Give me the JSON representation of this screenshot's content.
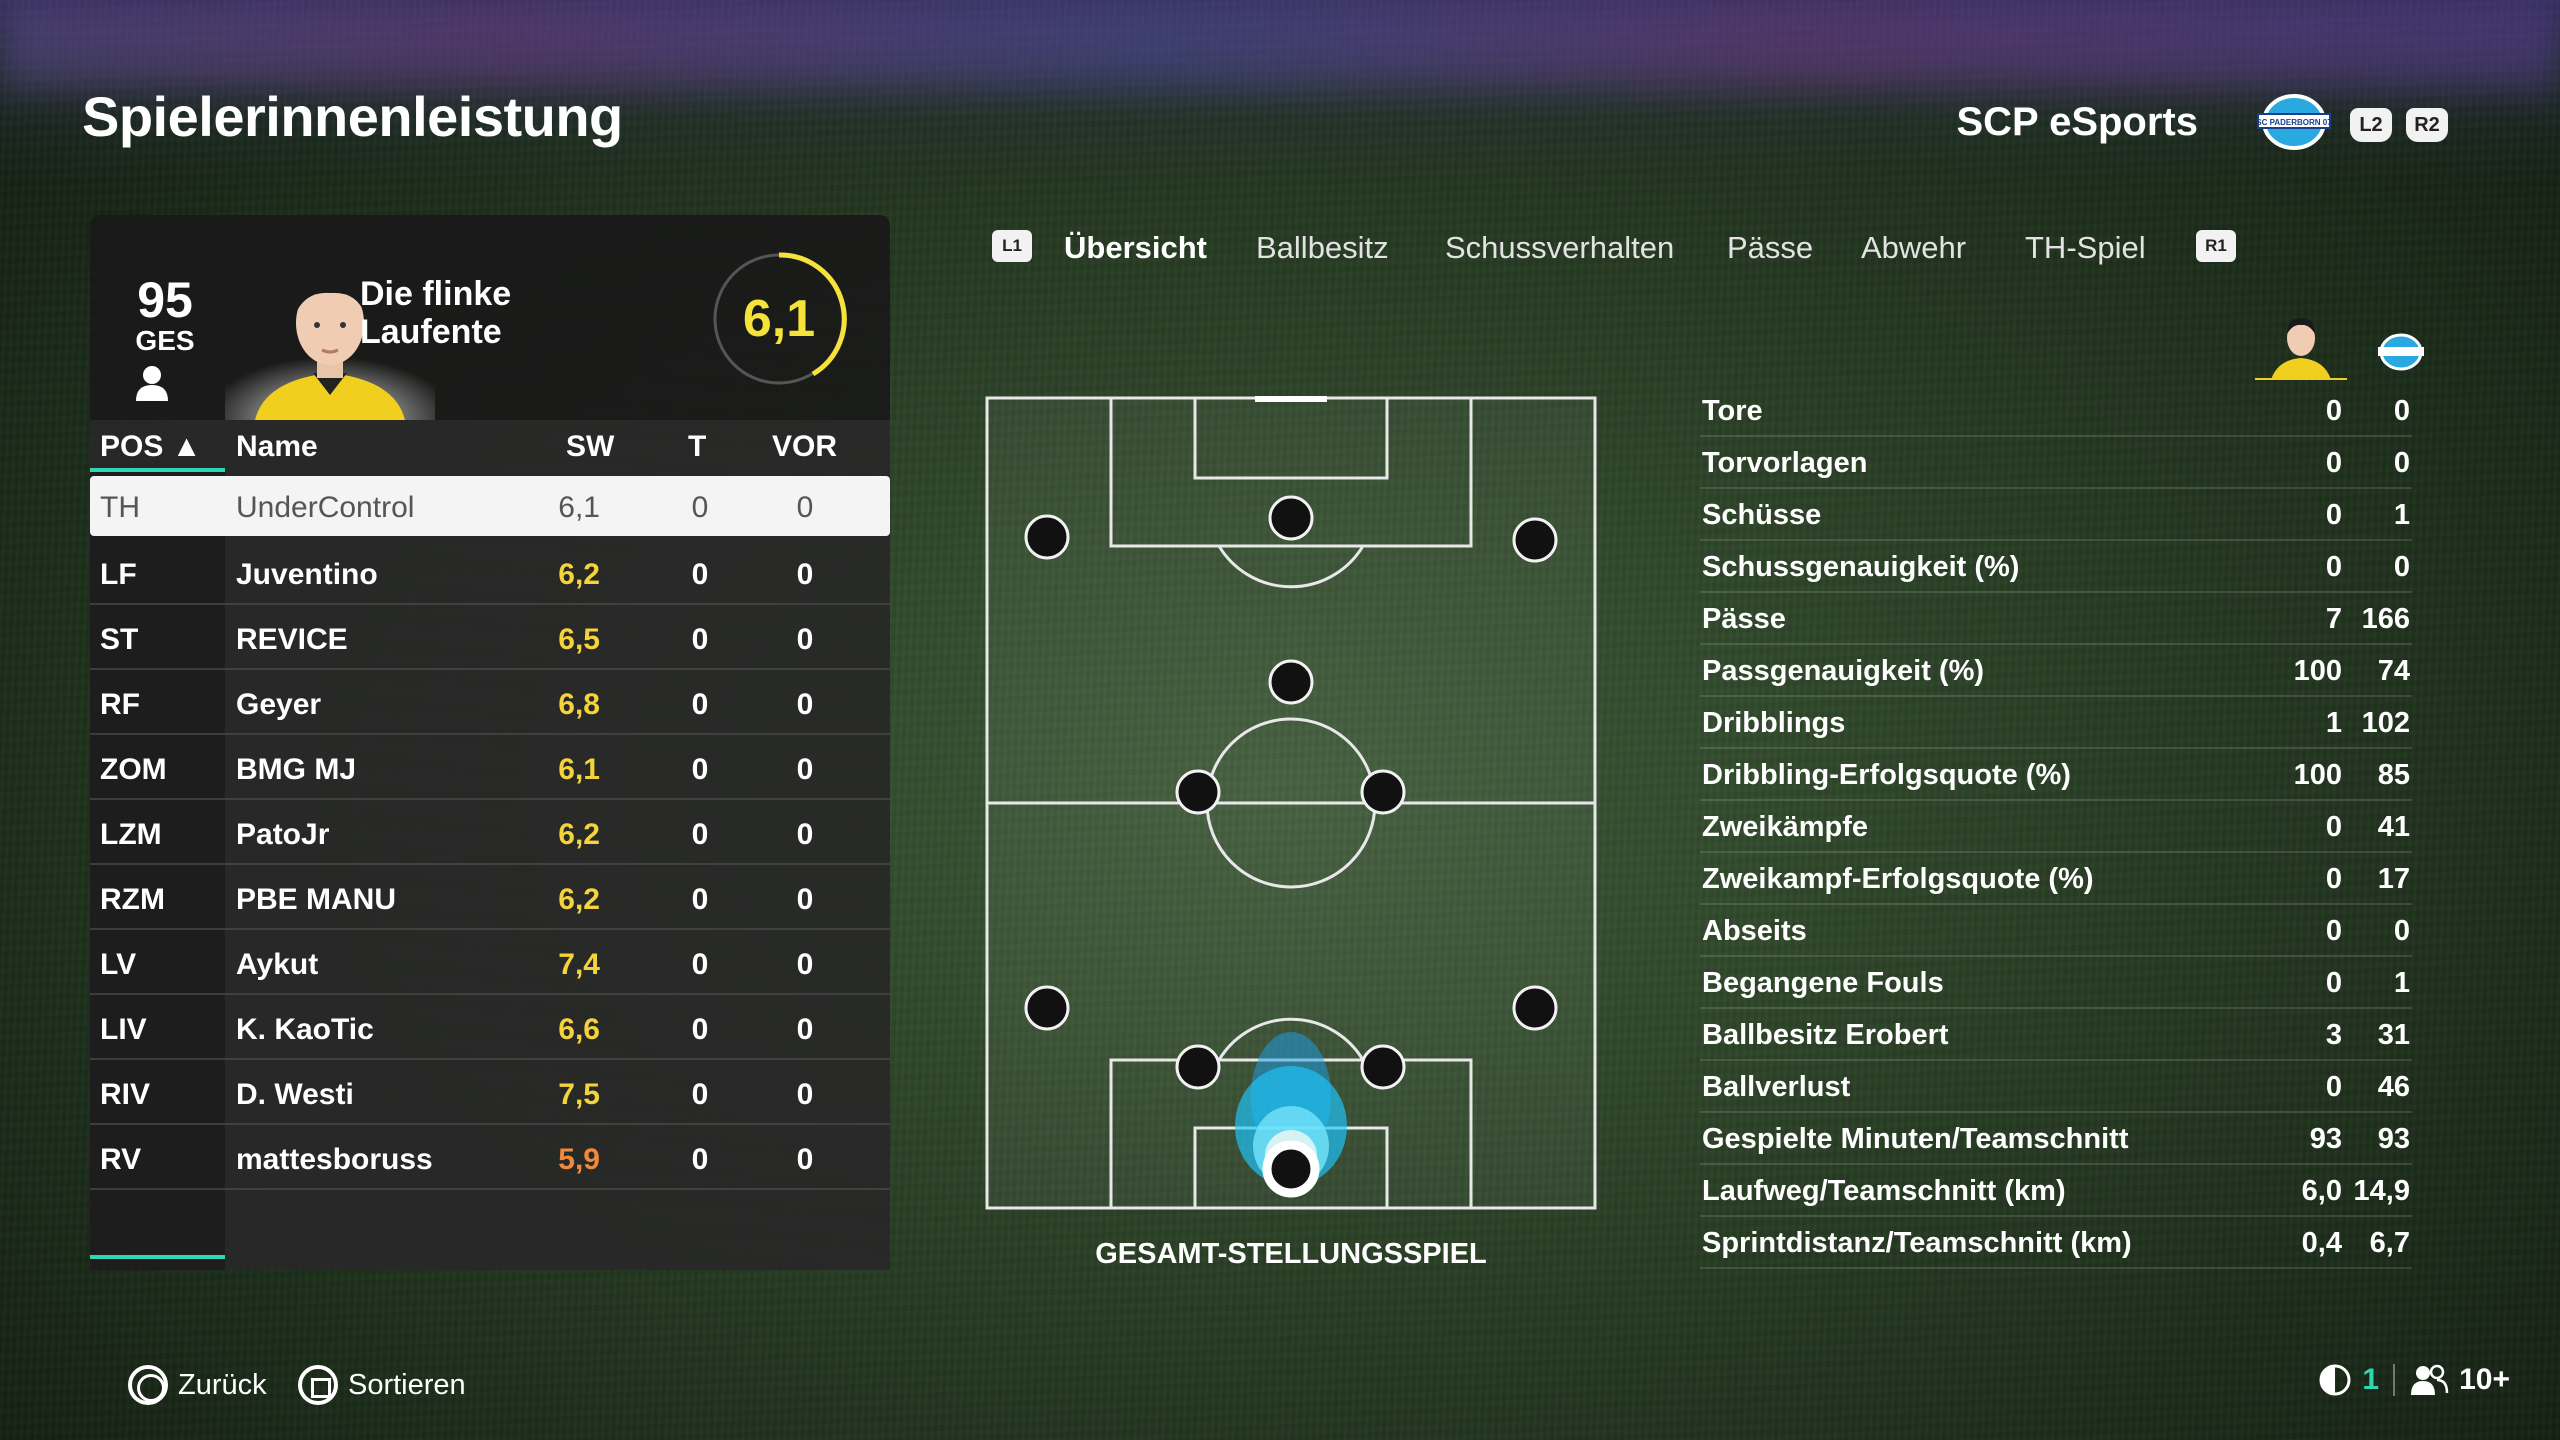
{
  "header": {
    "title": "Spielerinnenleistung",
    "team_name": "SCP eSports",
    "crest_text": "SC PADERBORN 07",
    "l2": "L2",
    "r2": "R2"
  },
  "player": {
    "overall": "95",
    "overall_label": "GES",
    "name_line1": "Die flinke",
    "name_line2": "Laufente",
    "rating": "6,1"
  },
  "table": {
    "headers": {
      "pos": "POS ▲",
      "name": "Name",
      "sw": "SW",
      "t": "T",
      "vor": "VOR"
    },
    "rows": [
      {
        "pos": "TH",
        "name": "UnderControl",
        "sw": "6,1",
        "sw_color": "#555555",
        "t": "0",
        "vor": "0"
      },
      {
        "pos": "LF",
        "name": "Juventino",
        "sw": "6,2",
        "sw_color": "#f5d33a",
        "t": "0",
        "vor": "0"
      },
      {
        "pos": "ST",
        "name": "REVICE",
        "sw": "6,5",
        "sw_color": "#f5d33a",
        "t": "0",
        "vor": "0"
      },
      {
        "pos": "RF",
        "name": "Geyer",
        "sw": "6,8",
        "sw_color": "#f5d33a",
        "t": "0",
        "vor": "0"
      },
      {
        "pos": "ZOM",
        "name": "BMG MJ",
        "sw": "6,1",
        "sw_color": "#f5d33a",
        "t": "0",
        "vor": "0"
      },
      {
        "pos": "LZM",
        "name": "PatoJr",
        "sw": "6,2",
        "sw_color": "#f5d33a",
        "t": "0",
        "vor": "0"
      },
      {
        "pos": "RZM",
        "name": "PBE MANU",
        "sw": "6,2",
        "sw_color": "#f5d33a",
        "t": "0",
        "vor": "0"
      },
      {
        "pos": "LV",
        "name": "Aykut",
        "sw": "7,4",
        "sw_color": "#f5d33a",
        "t": "0",
        "vor": "0"
      },
      {
        "pos": "LIV",
        "name": "K. KaoTic",
        "sw": "6,6",
        "sw_color": "#f5d33a",
        "t": "0",
        "vor": "0"
      },
      {
        "pos": "RIV",
        "name": "D. Westi",
        "sw": "7,5",
        "sw_color": "#f5d33a",
        "t": "0",
        "vor": "0"
      },
      {
        "pos": "RV",
        "name": "mattesboruss",
        "sw": "5,9",
        "sw_color": "#f08a3a",
        "t": "0",
        "vor": "0"
      }
    ]
  },
  "tabs": {
    "l1": "L1",
    "r1": "R1",
    "items": [
      "Übersicht",
      "Ballbesitz",
      "Schussverhalten",
      "Pässe",
      "Abwehr",
      "TH-Spiel"
    ],
    "active": 0
  },
  "pitch": {
    "caption": "GESAMT-STELLUNGSSPIEL"
  },
  "stats": [
    {
      "label": "Tore",
      "player": "0",
      "team": "0"
    },
    {
      "label": "Torvorlagen",
      "player": "0",
      "team": "0"
    },
    {
      "label": "Schüsse",
      "player": "0",
      "team": "1"
    },
    {
      "label": "Schussgenauigkeit (%)",
      "player": "0",
      "team": "0"
    },
    {
      "label": "Pässe",
      "player": "7",
      "team": "166"
    },
    {
      "label": "Passgenauigkeit (%)",
      "player": "100",
      "team": "74"
    },
    {
      "label": "Dribblings",
      "player": "1",
      "team": "102"
    },
    {
      "label": "Dribbling-Erfolgsquote (%)",
      "player": "100",
      "team": "85"
    },
    {
      "label": "Zweikämpfe",
      "player": "0",
      "team": "41"
    },
    {
      "label": "Zweikampf-Erfolgsquote (%)",
      "player": "0",
      "team": "17"
    },
    {
      "label": "Abseits",
      "player": "0",
      "team": "0"
    },
    {
      "label": "Begangene Fouls",
      "player": "0",
      "team": "1"
    },
    {
      "label": "Ballbesitz Erobert",
      "player": "3",
      "team": "31"
    },
    {
      "label": "Ballverlust",
      "player": "0",
      "team": "46"
    },
    {
      "label": "Gespielte Minuten/Teamschnitt",
      "player": "93",
      "team": "93"
    },
    {
      "label": "Laufweg/Teamschnitt (km)",
      "player": "6,0",
      "team": "14,9"
    },
    {
      "label": "Sprintdistanz/Teamschnitt (km)",
      "player": "0,4",
      "team": "6,7"
    }
  ],
  "footer": {
    "back": "Zurück",
    "sort": "Sortieren",
    "signal_value": "1",
    "players_online": "10+"
  },
  "colors": {
    "accent": "#2fd6b4",
    "rating_yellow": "#f5e23a",
    "heatmap_blue": "#1ec8ff"
  }
}
